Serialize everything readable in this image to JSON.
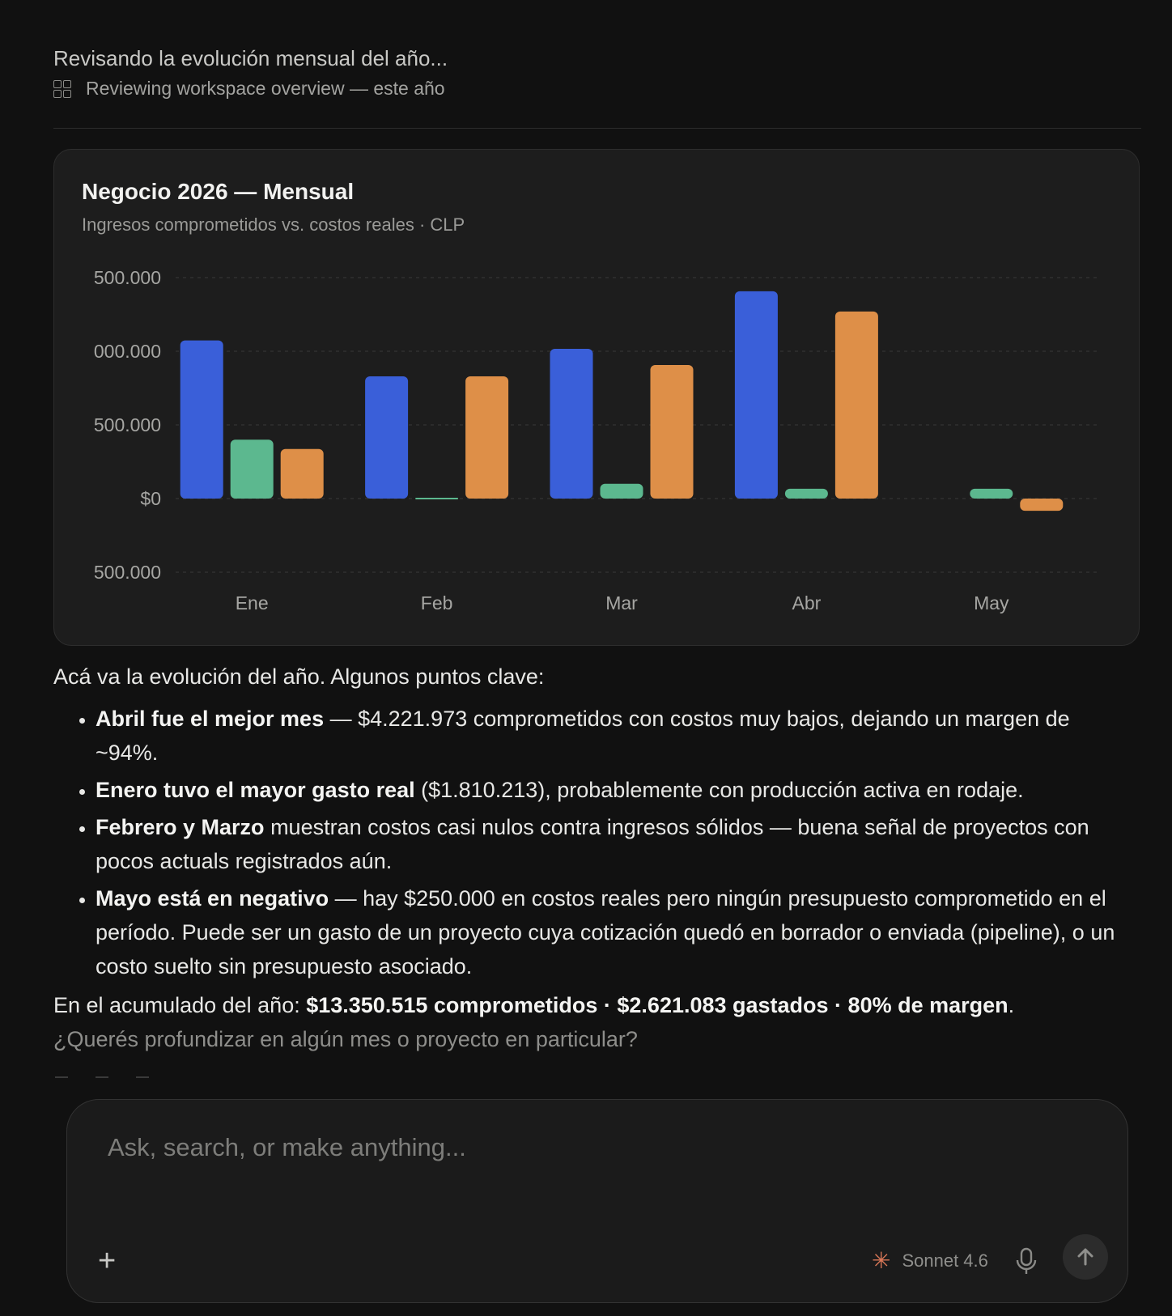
{
  "status": {
    "title": "Revisando la evolución mensual del año...",
    "subtitle": "Reviewing workspace overview — este año",
    "subtitle_icon": "grid-icon"
  },
  "chart_card": {
    "title": "Negocio 2026 — Mensual",
    "subtitle": "Ingresos comprometidos vs. costos reales · CLP"
  },
  "chart_data": {
    "type": "bar",
    "title": "Negocio 2026 — Mensual",
    "subtitle": "Ingresos comprometidos vs. costos reales · CLP",
    "categories": [
      "Ene",
      "Feb",
      "Mar",
      "Abr",
      "May"
    ],
    "series": [
      {
        "color": "#3a5fd9",
        "values": [
          3220000,
          2490000,
          3050000,
          4221973,
          null
        ]
      },
      {
        "color": "#5cb88f",
        "values": [
          1200000,
          5000,
          300000,
          200000,
          200000
        ]
      },
      {
        "color": "#de8f48",
        "values": [
          1010000,
          2490000,
          2720000,
          3810000,
          -250000
        ]
      }
    ],
    "y_ticks": [
      {
        "value": 4500000,
        "label": "500.000"
      },
      {
        "value": 3000000,
        "label": "000.000"
      },
      {
        "value": 1500000,
        "label": "500.000"
      },
      {
        "value": 0,
        "label": "$0"
      },
      {
        "value": -1500000,
        "label": "500.000"
      }
    ],
    "ylim": [
      -1500000,
      4500000
    ],
    "grid": true
  },
  "response": {
    "intro": "Acá va la evolución del año. Algunos puntos clave:",
    "bullets": [
      {
        "bold": "Abril fue el mejor mes",
        "text": " — $4.221.973 comprometidos con costos muy bajos, dejando un margen de ~94%."
      },
      {
        "bold": "Enero tuvo el mayor gasto real",
        "text": " ($1.810.213), probablemente con producción activa en rodaje."
      },
      {
        "bold": "Febrero y Marzo",
        "text": " muestran costos casi nulos contra ingresos sólidos — buena señal de proyectos con pocos actuals registrados aún."
      },
      {
        "bold": "Mayo está en negativo",
        "text": " — hay $250.000 en costos reales pero ningún presupuesto comprometido en el período. Puede ser un gasto de un proyecto cuya cotización quedó en borrador o enviada (pipeline), o un costo suelto sin presupuesto asociado."
      }
    ],
    "summary_prefix": "En el acumulado del año: ",
    "summary_bold": "$13.350.515 comprometidos · $2.621.083 gastados · 80% de margen",
    "summary_suffix": ".",
    "followup": "¿Querés profundizar en algún mes o proyecto en particular?"
  },
  "composer": {
    "placeholder": "Ask, search, or make anything...",
    "model_label": "Sonnet 4.6",
    "add_icon": "plus-icon",
    "model_icon": "sparkle-icon",
    "mic_icon": "microphone-icon",
    "send_icon": "arrow-up-icon"
  }
}
